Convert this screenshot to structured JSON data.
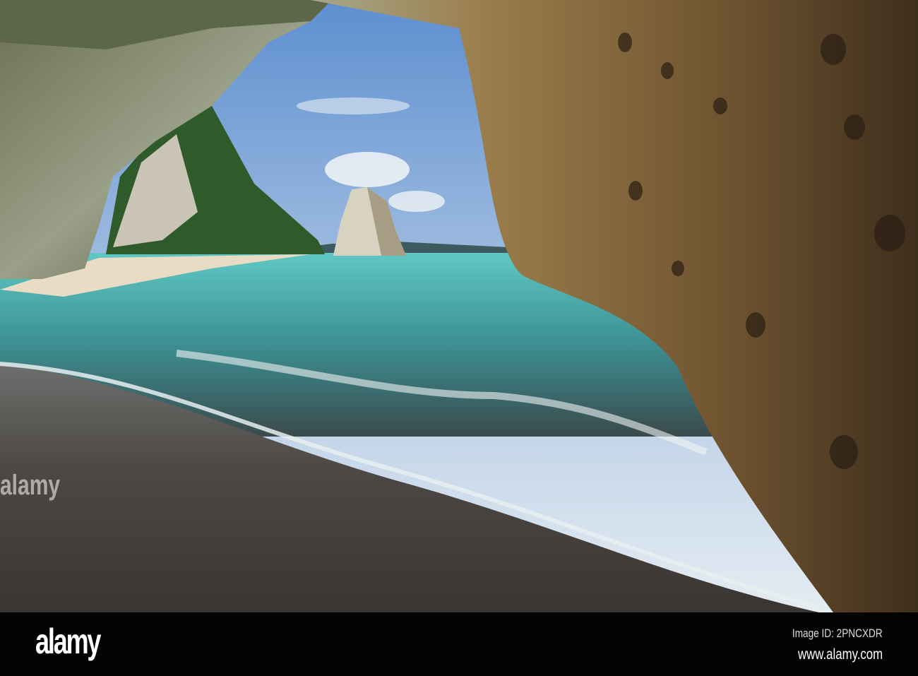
{
  "watermark": {
    "logo": "alamy",
    "image_id": "Image ID: 2PNCXDR",
    "url": "www.alamy.com"
  },
  "colors": {
    "sky": "#8fb3dc",
    "sea": "#5fc4c0",
    "sand": "#4a4643",
    "rock": "#8a6a3e",
    "bar": "#030303"
  }
}
